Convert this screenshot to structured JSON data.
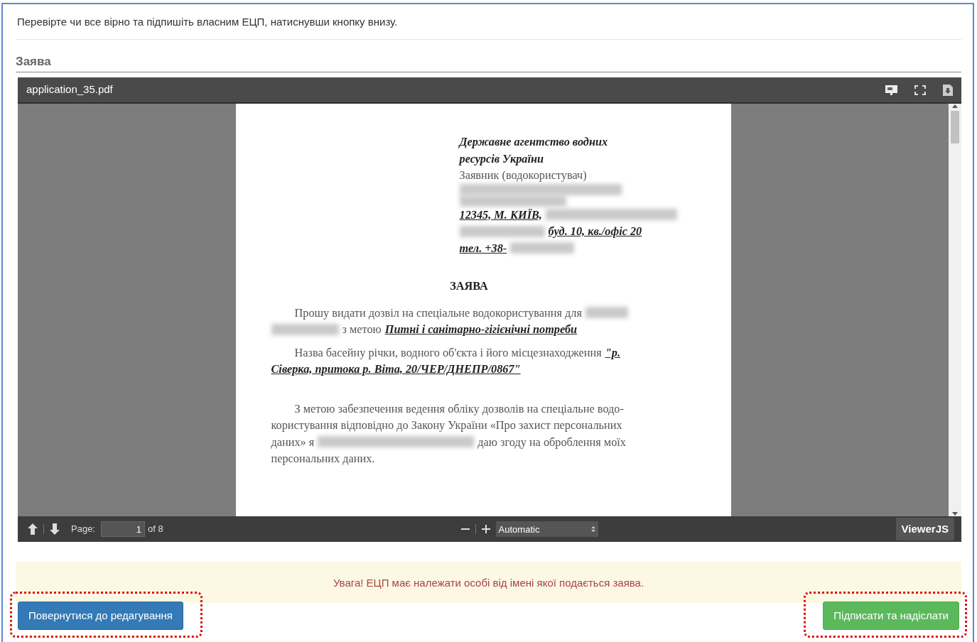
{
  "instruction": "Перевірте чи все вірно та підпишіть власним ЕЦП, натиснувши кнопку внизу.",
  "section_title": "Заява",
  "viewer": {
    "file_name": "application_35.pdf",
    "document": {
      "header": [
        [
          {
            "kind": "heading",
            "text": "Державне агентство водних"
          }
        ],
        [
          {
            "kind": "heading",
            "text": "ресурсів України"
          }
        ],
        [
          {
            "kind": "plain",
            "text": "Заявник (водокористувач)"
          }
        ],
        [
          {
            "kind": "redacted"
          }
        ],
        [
          {
            "kind": "redacted"
          }
        ],
        [
          {
            "kind": "emph",
            "text": "12345, М. КИЇВ,"
          },
          {
            "kind": "redacted"
          }
        ],
        [
          {
            "kind": "redacted"
          },
          {
            "kind": "emph",
            "text": "буд. 10, кв./офіс 20"
          }
        ],
        [
          {
            "kind": "emph",
            "text": "тел. +38-"
          },
          {
            "kind": "redacted"
          }
        ]
      ],
      "title": "ЗАЯВА",
      "paragraphs": [
        [
          [
            {
              "kind": "plain",
              "text": "Прошу видати дозвіл на спеціальне водокористування для"
            },
            {
              "kind": "redacted"
            }
          ],
          [
            {
              "kind": "redacted"
            },
            {
              "kind": "plain",
              "text": "з метою"
            },
            {
              "kind": "emph",
              "text": "Питні і санітарно-гігієнічні потреби"
            }
          ]
        ],
        [
          [
            {
              "kind": "plain",
              "text": "Назва басейну річки, водного об'єкта і його місцезнаходження"
            },
            {
              "kind": "emph",
              "text": "\"р."
            }
          ],
          [
            {
              "kind": "emph",
              "text": "Сіверка, притока р. Віта, 20/ЧЕР/ДНЕПР/0867\""
            }
          ]
        ],
        [
          [
            {
              "kind": "plain",
              "text": "З метою забезпечення ведення обліку дозволів на спеціальне водо-"
            }
          ],
          [
            {
              "kind": "plain",
              "text": "користування відповідно до Закону України «Про захист персональних"
            }
          ],
          [
            {
              "kind": "plain",
              "text": "даних» я"
            },
            {
              "kind": "redacted"
            },
            {
              "kind": "plain",
              "text": "даю згоду на оброблення моїх"
            }
          ],
          [
            {
              "kind": "plain",
              "text": "персональних даних."
            }
          ]
        ]
      ]
    },
    "page_label": "Page:",
    "page_value": "1",
    "page_total": "of 8",
    "zoom_value": "Automatic",
    "brand": "ViewerJS"
  },
  "warning": "Увага! ЕЦП має належати особі від імені якої подається заява.",
  "buttons": [
    {
      "label": "Повернутися до редагування",
      "kind": "back",
      "highlighted": true
    },
    {
      "label": "Підписати та надіслати",
      "kind": "submit",
      "highlighted": true
    }
  ]
}
